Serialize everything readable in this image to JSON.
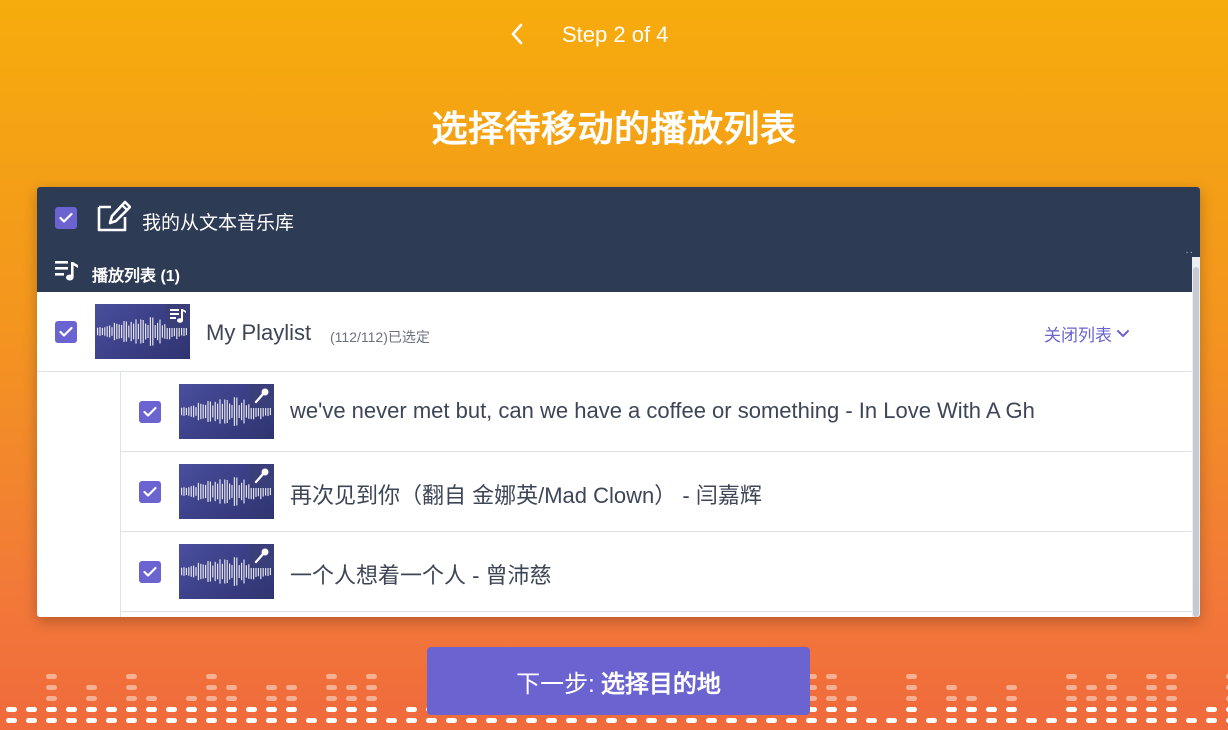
{
  "step": {
    "label": "Step 2 of 4",
    "back_icon": "chevron-left-icon"
  },
  "page_title": "选择待移动的播放列表",
  "library": {
    "name": "我的从文本音乐库",
    "checked": true,
    "icon": "edit-document-icon",
    "section_label": "播放列表 (1)",
    "section_icon": "playlist-icon"
  },
  "playlist": {
    "name": "My Playlist",
    "selected_count": "(112/112)已选定",
    "checked": true,
    "thumb_icon": "playlist-icon",
    "close_label": "关闭列表"
  },
  "tracks": [
    {
      "title": "we've never met but, can we have a coffee or something - In Love With A Gh",
      "checked": true,
      "thumb_icon": "microphone-icon"
    },
    {
      "title": "再次见到你（翻自 金娜英/Mad Clown） - 闫嘉辉",
      "checked": true,
      "thumb_icon": "microphone-icon"
    },
    {
      "title": "一个人想着一个人 - 曾沛慈",
      "checked": true,
      "thumb_icon": "microphone-icon"
    }
  ],
  "next_button": {
    "prefix": "下一步:",
    "action": "选择目的地"
  },
  "colors": {
    "accent": "#6b63cf",
    "header_bg": "#2e3b55",
    "background_top": "#f6ac0c",
    "background_bottom": "#f06a3c"
  }
}
